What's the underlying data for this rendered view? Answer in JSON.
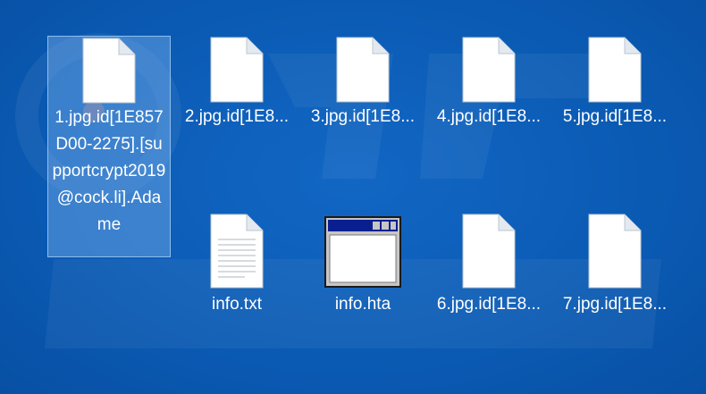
{
  "window": {
    "background_color": "#0b5cb5"
  },
  "files": [
    {
      "label": "1.jpg.id[1E857D00-2275].[supportcrypt2019@cock.li].Adame",
      "icon": "blank-file-icon",
      "selected": true
    },
    {
      "label": "2.jpg.id[1E8...",
      "icon": "blank-file-icon"
    },
    {
      "label": "3.jpg.id[1E8...",
      "icon": "blank-file-icon"
    },
    {
      "label": "4.jpg.id[1E8...",
      "icon": "blank-file-icon"
    },
    {
      "label": "5.jpg.id[1E8...",
      "icon": "blank-file-icon"
    },
    {
      "label": "info.txt",
      "icon": "text-file-icon"
    },
    {
      "label": "info.hta",
      "icon": "hta-application-icon"
    },
    {
      "label": "6.jpg.id[1E8...",
      "icon": "blank-file-icon"
    },
    {
      "label": "7.jpg.id[1E8...",
      "icon": "blank-file-icon"
    }
  ]
}
